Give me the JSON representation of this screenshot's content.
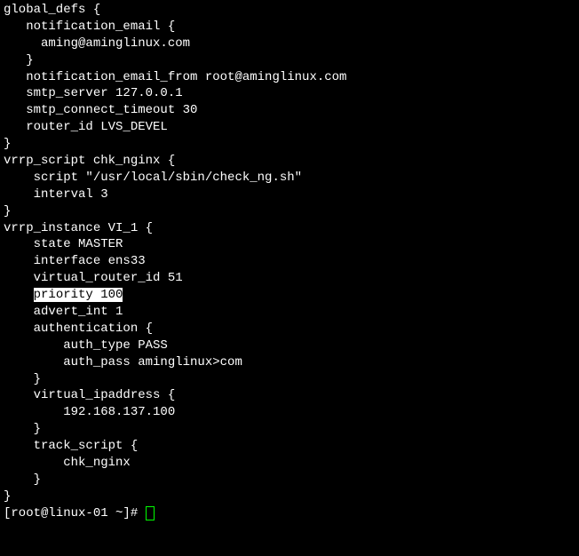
{
  "config": {
    "line1": "global_defs {",
    "line2": "   notification_email {",
    "line3": "     aming@aminglinux.com",
    "line4": "   }",
    "line5": "   notification_email_from root@aminglinux.com",
    "line6": "   smtp_server 127.0.0.1",
    "line7": "   smtp_connect_timeout 30",
    "line8": "   router_id LVS_DEVEL",
    "line9": "}",
    "line10": "vrrp_script chk_nginx {",
    "line11": "    script \"/usr/local/sbin/check_ng.sh\"",
    "line12": "    interval 3",
    "line13": "}",
    "line14": "vrrp_instance VI_1 {",
    "line15": "    state MASTER",
    "line16": "    interface ens33",
    "line17": "    virtual_router_id 51",
    "line18_prefix": "    ",
    "line18_highlight": "priority 100",
    "line19": "    advert_int 1",
    "line20": "    authentication {",
    "line21": "        auth_type PASS",
    "line22": "        auth_pass aminglinux>com",
    "line23": "    }",
    "line24": "    virtual_ipaddress {",
    "line25": "        192.168.137.100",
    "line26": "    }",
    "line27": "    track_script {",
    "line28": "        chk_nginx",
    "line29": "    }",
    "line30": "}"
  },
  "prompt": "[root@linux-01 ~]# "
}
